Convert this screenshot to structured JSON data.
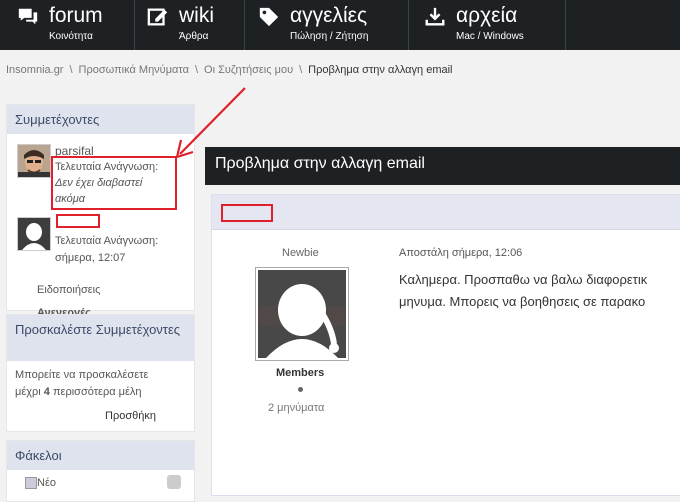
{
  "nav": {
    "items": [
      {
        "title": "forum",
        "sub": "Κοινότητα",
        "icon": "chat-icon"
      },
      {
        "title": "wiki",
        "sub": "Άρθρα",
        "icon": "edit-icon"
      },
      {
        "title": "αγγελίες",
        "sub": "Πώληση / Ζήτηση",
        "icon": "tag-icon"
      },
      {
        "title": "αρχεία",
        "sub": "Mac / Windows",
        "icon": "download-icon"
      }
    ]
  },
  "breadcrumb": {
    "items": [
      "Insomnia.gr",
      "Προσωπικά Μηνύματα",
      "Οι Συζητήσεις μου"
    ],
    "separator": "\\",
    "current": "Προβλημα στην αλλαγη email"
  },
  "participants": {
    "header": "Συμμετέχοντες",
    "list": [
      {
        "name": "parsifal",
        "last_read_label": "Τελευταία Ανάγνωση:",
        "last_read_value_1": "Δεν έχει διαβαστεί",
        "last_read_value_2": "ακόμα"
      },
      {
        "name": "",
        "last_read_label": "Τελευταία Ανάγνωση:",
        "last_read_value": "σήμερα, 12:07"
      }
    ],
    "notifications": "Ειδοποιήσεις",
    "partial": "Ανενεργές"
  },
  "invite": {
    "header": "Προσκαλέστε Συμμετέχοντες",
    "text_1": "Μπορείτε να προσκαλέσετε",
    "text_2_pre": "μέχρι ",
    "text_2_num": "4",
    "text_2_post": " περισσότερα μέλη",
    "add": "Προσθήκη"
  },
  "folders": {
    "header": "Φάκελοι",
    "first": "Νέο"
  },
  "thread": {
    "title": "Προβλημα στην αλλαγη email"
  },
  "post": {
    "usertitle": "Newbie",
    "date": "Αποστάλη σήμερα, 12:06",
    "group": "Members",
    "count": "2 μηνύματα",
    "line1": "Καλημερα. Προσπαθω να βαλω διαφορετικ",
    "line2": "μηνυμα. Μπορεις να βοηθησεις σε παρακο"
  },
  "colors": {
    "nav_bg": "#1d2124",
    "annotation_red": "#e0202a",
    "sidebar_header_bg": "#dfe3ed",
    "post_header_bg": "#e4e6f1"
  }
}
